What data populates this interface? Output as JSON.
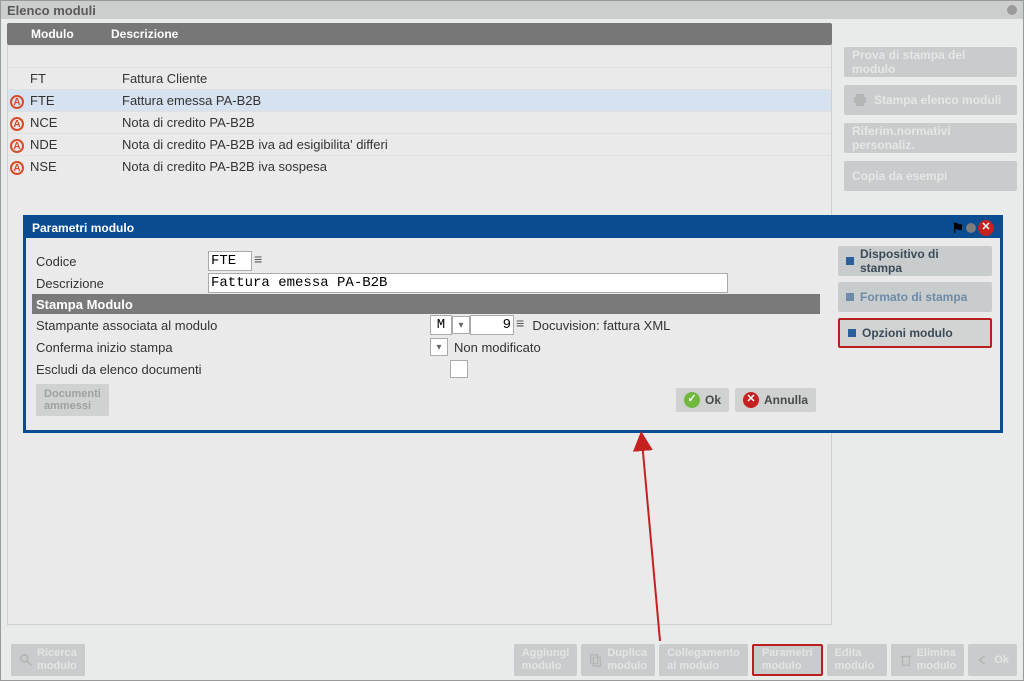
{
  "window_title": "Elenco moduli",
  "columns": {
    "modulo": "Modulo",
    "descrizione": "Descrizione"
  },
  "rows": [
    {
      "badge": false,
      "code": "FT",
      "desc": "Fattura Cliente"
    },
    {
      "badge": true,
      "code": "FTE",
      "desc": "Fattura emessa PA-B2B",
      "selected": true
    },
    {
      "badge": true,
      "code": "NCE",
      "desc": "Nota di credito PA-B2B"
    },
    {
      "badge": true,
      "code": "NDE",
      "desc": "Nota di credito PA-B2B iva ad esigibilita' differi"
    },
    {
      "badge": true,
      "code": "NSE",
      "desc": "Nota di credito PA-B2B iva sospesa"
    }
  ],
  "right_buttons": [
    "Prova di stampa del modulo",
    "Stampa elenco moduli",
    "Riferim.normativi personaliz.",
    "Copia da esempi"
  ],
  "bottom_buttons": {
    "ricerca": {
      "l1": "Ricerca",
      "l2": "modulo"
    },
    "aggiungi": {
      "l1": "Aggiungi",
      "l2": "modulo"
    },
    "duplica": {
      "l1": "Duplica",
      "l2": "modulo"
    },
    "collegamento": {
      "l1": "Collegamento",
      "l2": "al modulo"
    },
    "parametri": {
      "l1": "Parametri",
      "l2": "modulo"
    },
    "edita": {
      "l1": "Edita",
      "l2": "modulo"
    },
    "elimina": {
      "l1": "Elimina",
      "l2": "modulo"
    },
    "ok": "Ok"
  },
  "dialog": {
    "title": "Parametri modulo",
    "labels": {
      "codice": "Codice",
      "descrizione": "Descrizione",
      "section": "Stampa Modulo",
      "stampante": "Stampante associata al modulo",
      "conferma": "Conferma inizio stampa",
      "escludi": "Escludi da elenco documenti"
    },
    "values": {
      "codice": "FTE",
      "descrizione": "Fattura emessa PA-B2B",
      "printer_type": "M",
      "printer_num": "9",
      "printer_desc": "Docuvision: fattura XML",
      "conferma_val": "Non modificato"
    },
    "footer": {
      "doc_ammessi_l1": "Documenti",
      "doc_ammessi_l2": "ammessi",
      "ok": "Ok",
      "annulla": "Annulla"
    },
    "tabs": {
      "dispositivo": "Dispositivo di stampa",
      "formato": "Formato di stampa",
      "opzioni": "Opzioni modulo"
    }
  }
}
